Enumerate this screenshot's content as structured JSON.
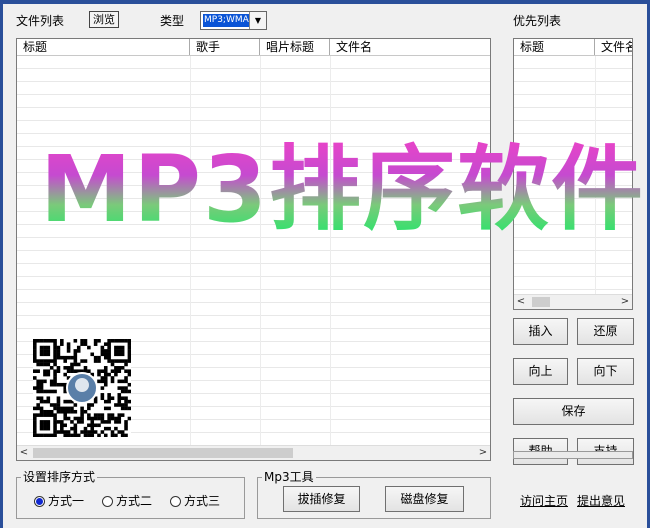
{
  "file_list": {
    "label": "文件列表",
    "browse_label": "浏览",
    "type_label": "类型",
    "type_value": "MP3;WMA",
    "columns": [
      "标题",
      "歌手",
      "唱片标题",
      "文件名"
    ]
  },
  "priority_list": {
    "label": "优先列表",
    "columns": [
      "标题",
      "文件名"
    ]
  },
  "watermark": "MP3排序软件",
  "buttons": {
    "insert": "插入",
    "restore": "还原",
    "up": "向上",
    "down": "向下",
    "save": "保存",
    "help": "帮助",
    "support": "支持"
  },
  "sort_group": {
    "title": "设置排序方式",
    "options": [
      "方式一",
      "方式二",
      "方式三"
    ],
    "selected_index": 0
  },
  "mp3_tools": {
    "title": "Mp3工具",
    "fix_label": "拔插修复",
    "disk_fix_label": "磁盘修复"
  },
  "links": {
    "homepage": "访问主页",
    "feedback": "提出意见"
  },
  "colors": {
    "frame": "#2a4f9a",
    "selection": "#0a54d6",
    "watermark_top": "#e844c8",
    "watermark_bottom": "#1ee86a"
  }
}
